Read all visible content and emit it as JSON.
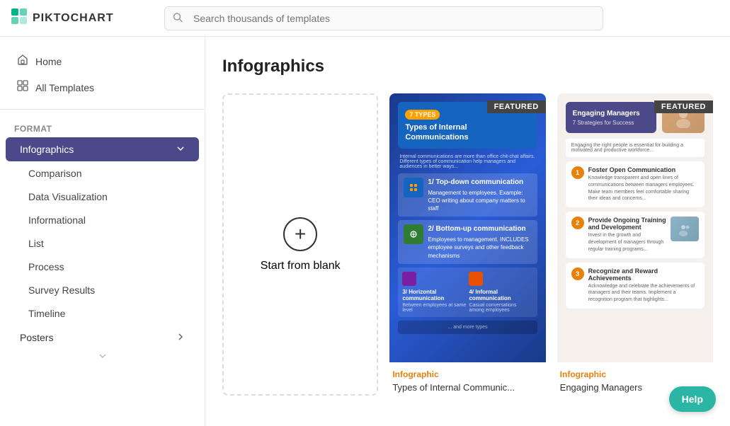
{
  "header": {
    "logo_text": "PIKTOCHART",
    "search_placeholder": "Search thousands of templates"
  },
  "sidebar": {
    "nav_items": [
      {
        "id": "home",
        "label": "Home",
        "icon": "🏠"
      },
      {
        "id": "all-templates",
        "label": "All Templates",
        "icon": "⊞"
      }
    ],
    "format_label": "Format",
    "categories": [
      {
        "id": "infographics",
        "label": "Infographics",
        "active": true,
        "expanded": true,
        "sub_items": [
          {
            "id": "comparison",
            "label": "Comparison"
          },
          {
            "id": "data-visualization",
            "label": "Data Visualization"
          },
          {
            "id": "informational",
            "label": "Informational"
          },
          {
            "id": "list",
            "label": "List"
          },
          {
            "id": "process",
            "label": "Process"
          },
          {
            "id": "survey-results",
            "label": "Survey Results"
          },
          {
            "id": "timeline",
            "label": "Timeline"
          }
        ]
      },
      {
        "id": "posters",
        "label": "Posters",
        "active": false,
        "expanded": false
      }
    ]
  },
  "content": {
    "title": "Infographics",
    "blank_card_label": "Start from blank",
    "templates": [
      {
        "id": "internal-comms",
        "category_tag": "Infographic",
        "name": "Types of Internal Communic...",
        "featured": true,
        "featured_label": "FEATURED"
      },
      {
        "id": "engaging-managers",
        "category_tag": "Infographic",
        "name": "Engaging Managers",
        "featured": true,
        "featured_label": "FEATURED"
      }
    ]
  },
  "help_button_label": "Help"
}
